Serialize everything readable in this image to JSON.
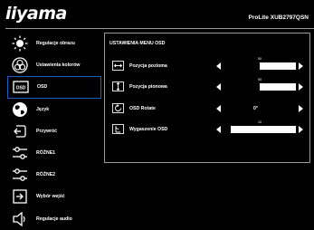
{
  "brand": "iiyama",
  "model": "ProLite XUB2797QSN",
  "sidebar": {
    "items": [
      {
        "label": "Regulacje obrazu",
        "icon": "sun-brightness-icon"
      },
      {
        "label": "Ustawienia kolorów",
        "icon": "color-circles-icon"
      },
      {
        "label": "OSD",
        "icon": "osd-screen-icon",
        "active": true
      },
      {
        "label": "Język",
        "icon": "globe-icon"
      },
      {
        "label": "Przywróć",
        "icon": "reset-icon"
      },
      {
        "label": "RÓŻNE1",
        "icon": "sliders-icon"
      },
      {
        "label": "RÓŻNE2",
        "icon": "sliders-icon"
      },
      {
        "label": "Wybór wejść",
        "icon": "input-select-icon"
      },
      {
        "label": "Regulacje audio",
        "icon": "speaker-icon"
      }
    ]
  },
  "panel": {
    "title": "USTAWIENIA MENU OSD",
    "rows": [
      {
        "label": "Pozycja pozioma",
        "icon": "horizontal-position-icon",
        "type": "bar",
        "value": 50,
        "value_text": "50"
      },
      {
        "label": "Pozycja pionowa",
        "icon": "vertical-position-icon",
        "type": "bar",
        "value": 50,
        "value_text": "50"
      },
      {
        "label": "OSD Rotate",
        "icon": "rotate-icon",
        "type": "text",
        "value_text": "0°"
      },
      {
        "label": "Wygaszenie OSD",
        "icon": "timer-icon",
        "type": "bar",
        "value": 10,
        "value_text": "10"
      }
    ]
  }
}
